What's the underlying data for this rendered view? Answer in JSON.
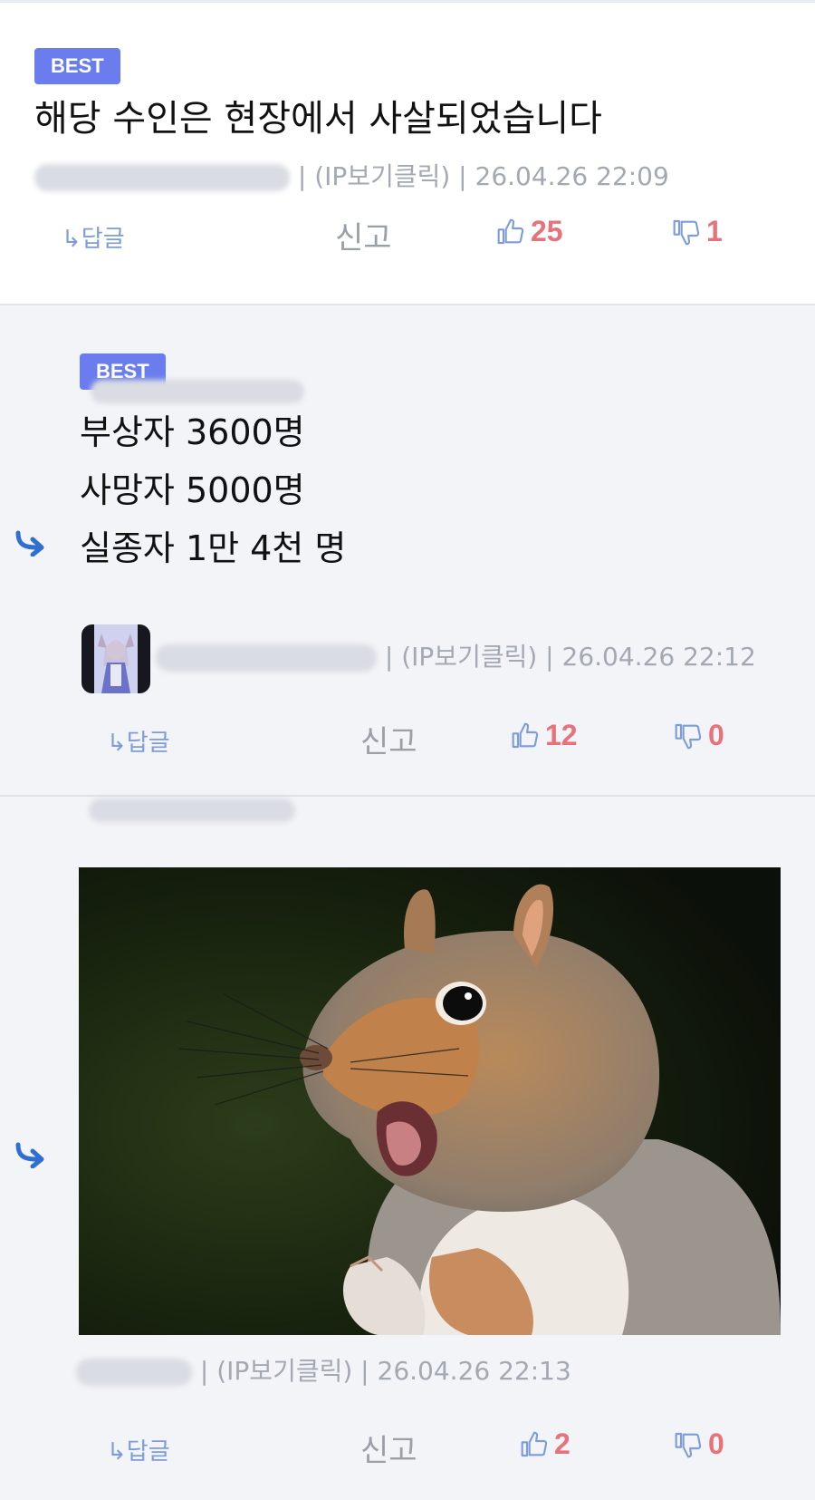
{
  "comments": [
    {
      "badge": "BEST",
      "text_lines": [
        "해당 수인은 현장에서 사살되었습니다"
      ],
      "meta": "| (IP보기클릭) | 26.04.26 22:09",
      "reply_label": "↳답글",
      "report_label": "신고",
      "likes": "25",
      "dislikes": "1"
    },
    {
      "badge": "BEST",
      "text_lines": [
        "부상자 3600명",
        "사망자 5000명",
        "실종자 1만 4천 명"
      ],
      "meta": "| (IP보기클릭) | 26.04.26 22:12",
      "reply_label": "↳답글",
      "report_label": "신고",
      "likes": "12",
      "dislikes": "0"
    },
    {
      "meta": "| (IP보기클릭) | 26.04.26 22:13",
      "reply_label": "↳답글",
      "report_label": "신고",
      "likes": "2",
      "dislikes": "0"
    }
  ],
  "colors": {
    "badge": "#6b7dee",
    "vote_count": "#e7727b",
    "thumb_icon": "#7d9cd9",
    "reply_arrow": "#2f6fd0"
  },
  "icons": [
    "reply-arrow-icon",
    "thumbs-up-icon",
    "thumbs-down-icon"
  ]
}
